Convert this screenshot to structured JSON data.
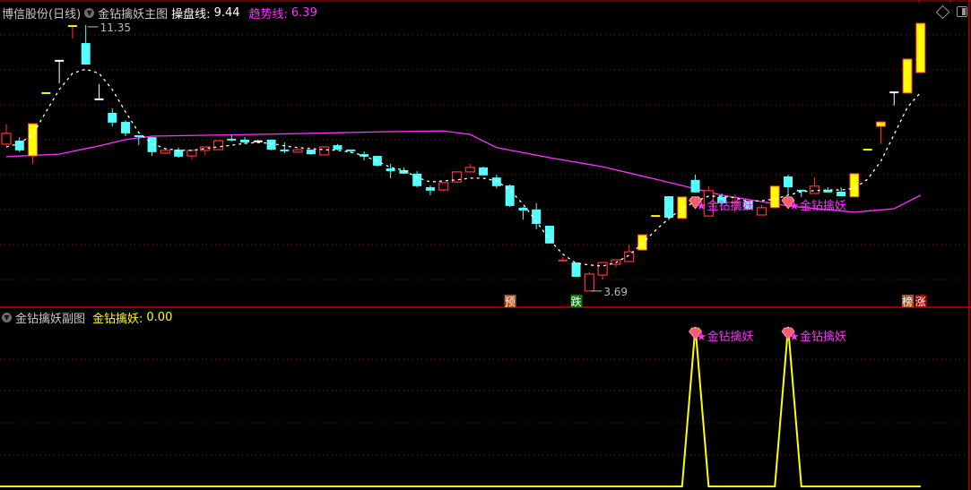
{
  "header": {
    "stock": "博信股份(日线)",
    "main_indicator": "金钻擒妖主图",
    "line1_label": "操盘线:",
    "line1_value": "9.44",
    "line2_label": "趋势线:",
    "line2_value": "6.39"
  },
  "sub_header": {
    "indicator": "金钻擒妖副图",
    "series_label": "金钻擒妖:",
    "series_value": "0.00"
  },
  "icons": {
    "collapse": "chevron-down-circle-icon",
    "top_right": [
      "diamond-icon",
      "panel-toggle-icon"
    ]
  },
  "colors": {
    "background": "#000000",
    "up": "#ff3232",
    "down": "#54ffff",
    "limit": "#ffff00",
    "flat": "#ffffff",
    "trend_line": "#ff32ff",
    "operate_line": "#ffffff",
    "grid": "#8a1a1a",
    "border": "#c80000",
    "signal_text": "#ff32ff",
    "sub_line": "#ffff00"
  },
  "chart_data": [
    {
      "type": "candlestick",
      "ylim": [
        3.3,
        12.07
      ],
      "grid": true,
      "candles": [
        [
          7.92,
          8.49,
          7.87,
          8.23,
          "up"
        ],
        [
          8.02,
          8.12,
          7.69,
          7.74,
          "down"
        ],
        [
          7.58,
          8.51,
          7.35,
          8.51,
          "limit"
        ],
        [
          9.39,
          9.39,
          9.39,
          9.39,
          "limit"
        ],
        [
          10.32,
          10.32,
          9.67,
          10.32,
          "flat"
        ],
        [
          11.32,
          11.32,
          10.96,
          11.32,
          "limit"
        ],
        [
          10.83,
          11.35,
          10.21,
          10.21,
          "down"
        ],
        [
          9.21,
          9.65,
          9.21,
          9.21,
          "flat"
        ],
        [
          8.82,
          8.95,
          8.43,
          8.54,
          "down"
        ],
        [
          8.56,
          8.61,
          8.15,
          8.23,
          "down"
        ],
        [
          8.15,
          8.15,
          7.89,
          8.13,
          "down"
        ],
        [
          8.12,
          8.12,
          7.58,
          7.69,
          "down"
        ],
        [
          7.66,
          7.79,
          7.63,
          7.74,
          "up"
        ],
        [
          7.76,
          7.82,
          7.53,
          7.56,
          "down"
        ],
        [
          7.58,
          7.74,
          7.48,
          7.74,
          "up"
        ],
        [
          7.74,
          7.84,
          7.61,
          7.84,
          "up"
        ],
        [
          7.76,
          8.02,
          7.76,
          8.02,
          "up"
        ],
        [
          8.05,
          8.18,
          8.0,
          8.0,
          "down"
        ],
        [
          8.05,
          8.12,
          7.92,
          7.97,
          "down"
        ],
        [
          8.0,
          8.05,
          7.94,
          8.0,
          "flat"
        ],
        [
          8.05,
          8.05,
          7.74,
          7.76,
          "down"
        ],
        [
          7.74,
          7.97,
          7.66,
          7.69,
          "down"
        ],
        [
          7.69,
          7.79,
          7.69,
          7.76,
          "up"
        ],
        [
          7.76,
          7.76,
          7.61,
          7.63,
          "down"
        ],
        [
          7.61,
          7.84,
          7.61,
          7.84,
          "up"
        ],
        [
          7.89,
          7.92,
          7.74,
          7.76,
          "down"
        ],
        [
          7.74,
          7.76,
          7.66,
          7.69,
          "down"
        ],
        [
          7.63,
          7.71,
          7.45,
          7.56,
          "down"
        ],
        [
          7.58,
          7.58,
          7.27,
          7.3,
          "down"
        ],
        [
          7.22,
          7.35,
          6.94,
          7.14,
          "down"
        ],
        [
          7.17,
          7.25,
          7.07,
          7.07,
          "down"
        ],
        [
          7.07,
          7.14,
          6.68,
          6.71,
          "down"
        ],
        [
          6.68,
          6.73,
          6.45,
          6.58,
          "down"
        ],
        [
          6.6,
          6.81,
          6.55,
          6.81,
          "up"
        ],
        [
          6.83,
          7.14,
          6.81,
          7.12,
          "up"
        ],
        [
          7.12,
          7.35,
          7.12,
          7.25,
          "up"
        ],
        [
          7.25,
          7.27,
          7.02,
          7.02,
          "down"
        ],
        [
          6.96,
          7.04,
          6.65,
          6.71,
          "down"
        ],
        [
          6.73,
          6.76,
          6.11,
          6.14,
          "down"
        ],
        [
          6.09,
          6.11,
          5.75,
          6.01,
          "down"
        ],
        [
          6.04,
          6.22,
          5.47,
          5.62,
          "down"
        ],
        [
          5.57,
          5.57,
          5.06,
          5.06,
          "down"
        ],
        [
          4.54,
          4.67,
          4.54,
          4.57,
          "up"
        ],
        [
          4.51,
          4.51,
          4.1,
          4.1,
          "down"
        ],
        [
          3.69,
          4.23,
          3.69,
          4.18,
          "up"
        ],
        [
          4.15,
          4.51,
          4.02,
          4.51,
          "up"
        ],
        [
          4.46,
          4.59,
          4.38,
          4.59,
          "up"
        ],
        [
          4.54,
          5.03,
          4.54,
          4.82,
          "up"
        ],
        [
          4.87,
          5.31,
          4.87,
          5.31,
          "limit"
        ],
        [
          5.85,
          5.85,
          5.85,
          5.85,
          "limit"
        ],
        [
          6.42,
          6.42,
          5.73,
          5.8,
          "down"
        ],
        [
          5.78,
          6.4,
          5.78,
          6.4,
          "limit"
        ],
        [
          6.89,
          7.04,
          6.53,
          6.53,
          "down"
        ],
        [
          5.85,
          6.71,
          5.85,
          6.58,
          "up"
        ],
        [
          6.4,
          6.5,
          6.17,
          6.22,
          "down"
        ],
        [
          6.19,
          6.47,
          5.96,
          6.24,
          "up"
        ],
        [
          6.29,
          6.29,
          6.04,
          6.04,
          "down"
        ],
        [
          5.88,
          6.17,
          5.88,
          6.09,
          "up"
        ],
        [
          6.09,
          6.71,
          6.09,
          6.71,
          "limit"
        ],
        [
          6.99,
          7.04,
          6.47,
          6.68,
          "down"
        ],
        [
          6.58,
          6.6,
          6.4,
          6.53,
          "down"
        ],
        [
          6.5,
          6.96,
          6.5,
          6.71,
          "up"
        ],
        [
          6.6,
          6.68,
          6.53,
          6.53,
          "down"
        ],
        [
          6.55,
          6.68,
          6.42,
          6.42,
          "down"
        ],
        [
          6.4,
          7.07,
          6.4,
          7.07,
          "limit"
        ],
        [
          7.76,
          7.76,
          7.76,
          7.76,
          "limit"
        ],
        [
          8.43,
          8.56,
          7.92,
          8.56,
          "limit"
        ],
        [
          9.41,
          9.41,
          9.03,
          9.41,
          "flat"
        ],
        [
          9.39,
          10.37,
          9.39,
          10.37,
          "limit"
        ],
        [
          9.98,
          11.4,
          9.98,
          11.4,
          "limit"
        ]
      ],
      "operate_line": [
        7.84,
        7.94,
        8.2,
        8.85,
        9.49,
        9.96,
        10.08,
        9.96,
        9.49,
        8.85,
        8.25,
        7.94,
        7.79,
        7.74,
        7.74,
        7.79,
        7.84,
        7.89,
        7.94,
        7.97,
        7.94,
        7.87,
        7.82,
        7.79,
        7.76,
        7.74,
        7.69,
        7.58,
        7.43,
        7.25,
        7.17,
        6.96,
        6.83,
        6.86,
        6.89,
        6.94,
        6.94,
        6.86,
        6.6,
        6.19,
        5.7,
        5.16,
        4.75,
        4.49,
        4.44,
        4.41,
        4.51,
        4.72,
        5.06,
        5.44,
        5.78,
        6.06,
        6.27,
        6.42,
        6.42,
        6.37,
        6.27,
        6.29,
        6.34,
        6.45,
        6.55,
        6.58,
        6.6,
        6.6,
        6.65,
        6.91,
        7.43,
        8.2,
        8.98,
        9.41
      ],
      "trend_line_knots": [
        [
          1,
          7.56
        ],
        [
          5,
          7.63
        ],
        [
          8,
          7.87
        ],
        [
          10,
          8.05
        ],
        [
          12,
          8.15
        ],
        [
          20,
          8.2
        ],
        [
          30,
          8.28
        ],
        [
          34,
          8.3
        ],
        [
          36,
          8.2
        ],
        [
          38,
          7.82
        ],
        [
          42,
          7.53
        ],
        [
          46,
          7.27
        ],
        [
          50,
          6.91
        ],
        [
          55,
          6.45
        ],
        [
          60,
          6.14
        ],
        [
          65,
          5.96
        ],
        [
          68,
          6.06
        ],
        [
          70,
          6.45
        ]
      ],
      "annotations": [
        {
          "candle": 7,
          "text": "11.35",
          "kind": "high"
        },
        {
          "candle": 45,
          "text": "3.69",
          "kind": "low"
        }
      ],
      "signals": [
        {
          "candle": 53,
          "price": 6.22,
          "text": "金钻擒妖"
        },
        {
          "candle": 60,
          "price": 6.22,
          "text": "金钻擒妖"
        }
      ],
      "badges": [
        {
          "candle": 39,
          "text": "预",
          "color": "#b0501a"
        },
        {
          "candle": 44,
          "text": "跌",
          "color": "#0a7a0a"
        },
        {
          "candle": 69,
          "text": "榜",
          "color": "#b0501a"
        },
        {
          "candle": 70,
          "text": "涨",
          "color": "#a00000"
        }
      ]
    },
    {
      "type": "line",
      "name": "金钻擒妖",
      "ylim": [
        0,
        1
      ],
      "grid": true,
      "values": [
        0,
        0,
        0,
        0,
        0,
        0,
        0,
        0,
        0,
        0,
        0,
        0,
        0,
        0,
        0,
        0,
        0,
        0,
        0,
        0,
        0,
        0,
        0,
        0,
        0,
        0,
        0,
        0,
        0,
        0,
        0,
        0,
        0,
        0,
        0,
        0,
        0,
        0,
        0,
        0,
        0,
        0,
        0,
        0,
        0,
        0,
        0,
        0,
        0,
        0,
        0,
        0,
        1,
        0,
        0,
        0,
        0,
        0,
        0,
        1,
        0,
        0,
        0,
        0,
        0,
        0,
        0,
        0,
        0,
        0
      ],
      "signals": [
        {
          "candle": 53,
          "text": "金钻擒妖"
        },
        {
          "candle": 60,
          "text": "金钻擒妖"
        }
      ]
    }
  ]
}
